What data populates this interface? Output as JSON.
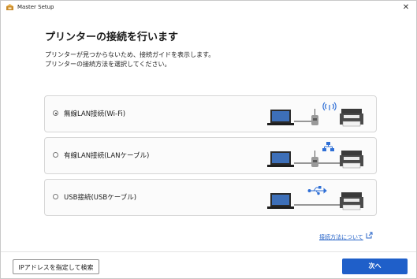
{
  "window": {
    "title": "Master Setup"
  },
  "page": {
    "heading": "プリンターの接続を行います",
    "description": [
      "プリンターが見つからないため、接続ガイドを表示します。",
      "プリンターの接続方法を選択してください。"
    ]
  },
  "options": [
    {
      "label": "無線LAN接続(Wi-Fi)",
      "selected": true,
      "icon": "wireless-connection-illustration"
    },
    {
      "label": "有線LAN接続(LANケーブル)",
      "selected": false,
      "icon": "wired-lan-connection-illustration"
    },
    {
      "label": "USB接続(USBケーブル)",
      "selected": false,
      "icon": "usb-connection-illustration"
    }
  ],
  "help_link": {
    "label": "接続方法について"
  },
  "buttons": {
    "ip_search": "IPアドレスを指定して検索",
    "next": "次へ"
  },
  "colors": {
    "accent": "#1f5fc9",
    "wifi_blue": "#2f6fd6",
    "link": "#2a66c9"
  }
}
